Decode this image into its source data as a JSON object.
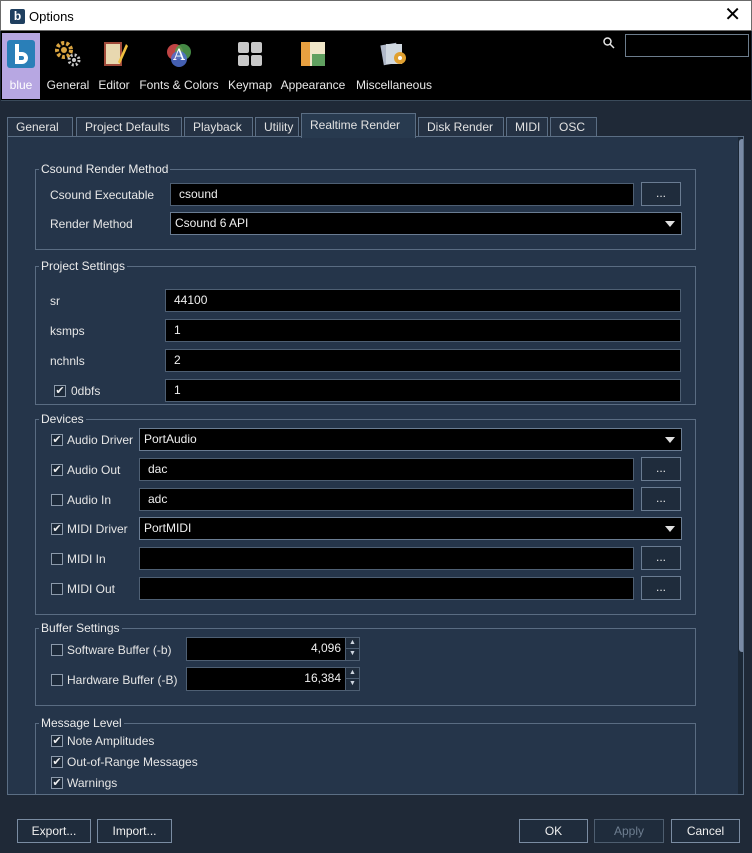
{
  "window": {
    "title": "Options",
    "app_icon_letter": "b",
    "close_glyph": "✕"
  },
  "toolbar": {
    "categories": [
      {
        "label": "blue",
        "icon": "blue-logo-icon",
        "selected": true
      },
      {
        "label": "General",
        "icon": "gears-icon"
      },
      {
        "label": "Editor",
        "icon": "book-pen-icon"
      },
      {
        "label": "Fonts & Colors",
        "icon": "font-colors-icon"
      },
      {
        "label": "Keymap",
        "icon": "keyboard-keys-icon"
      },
      {
        "label": "Appearance",
        "icon": "window-layout-icon"
      },
      {
        "label": "Miscellaneous",
        "icon": "misc-gear-cards-icon"
      }
    ],
    "search_value": ""
  },
  "tabs": [
    {
      "label": "General"
    },
    {
      "label": "Project Defaults"
    },
    {
      "label": "Playback"
    },
    {
      "label": "Utility"
    },
    {
      "label": "Realtime Render",
      "active": true
    },
    {
      "label": "Disk Render"
    },
    {
      "label": "MIDI"
    },
    {
      "label": "OSC"
    }
  ],
  "csound_render": {
    "legend": "Csound Render Method",
    "executable_label": "Csound Executable",
    "executable_value": "csound",
    "method_label": "Render Method",
    "method_value": "Csound 6 API"
  },
  "project_settings": {
    "legend": "Project Settings",
    "sr_label": "sr",
    "sr_value": "44100",
    "ksmps_label": "ksmps",
    "ksmps_value": "1",
    "nchnls_label": "nchnls",
    "nchnls_value": "2",
    "zerodbfs_label": "0dbfs",
    "zerodbfs_value": "1",
    "zerodbfs_checked": true
  },
  "devices": {
    "legend": "Devices",
    "audio_driver_label": "Audio Driver",
    "audio_driver_value": "PortAudio",
    "audio_driver_checked": true,
    "audio_out_label": "Audio Out",
    "audio_out_value": "dac",
    "audio_out_checked": true,
    "audio_in_label": "Audio In",
    "audio_in_value": "adc",
    "audio_in_checked": false,
    "midi_driver_label": "MIDI Driver",
    "midi_driver_value": "PortMIDI",
    "midi_driver_checked": true,
    "midi_in_label": "MIDI In",
    "midi_in_value": "",
    "midi_in_checked": false,
    "midi_out_label": "MIDI Out",
    "midi_out_value": "",
    "midi_out_checked": false
  },
  "buffer_settings": {
    "legend": "Buffer Settings",
    "software_label": "Software Buffer (-b)",
    "software_value": "4,096",
    "software_checked": false,
    "hardware_label": "Hardware Buffer (-B)",
    "hardware_value": "16,384",
    "hardware_checked": false
  },
  "message_level": {
    "legend": "Message Level",
    "note_amplitudes_label": "Note Amplitudes",
    "note_amplitudes_checked": true,
    "out_of_range_label": "Out-of-Range Messages",
    "out_of_range_checked": true,
    "warnings_label": "Warnings",
    "warnings_checked": true
  },
  "common": {
    "browse_label": "...",
    "check_glyph": "✔"
  },
  "footer": {
    "export_label": "Export...",
    "import_label": "Import...",
    "ok_label": "OK",
    "apply_label": "Apply",
    "cancel_label": "Cancel"
  }
}
